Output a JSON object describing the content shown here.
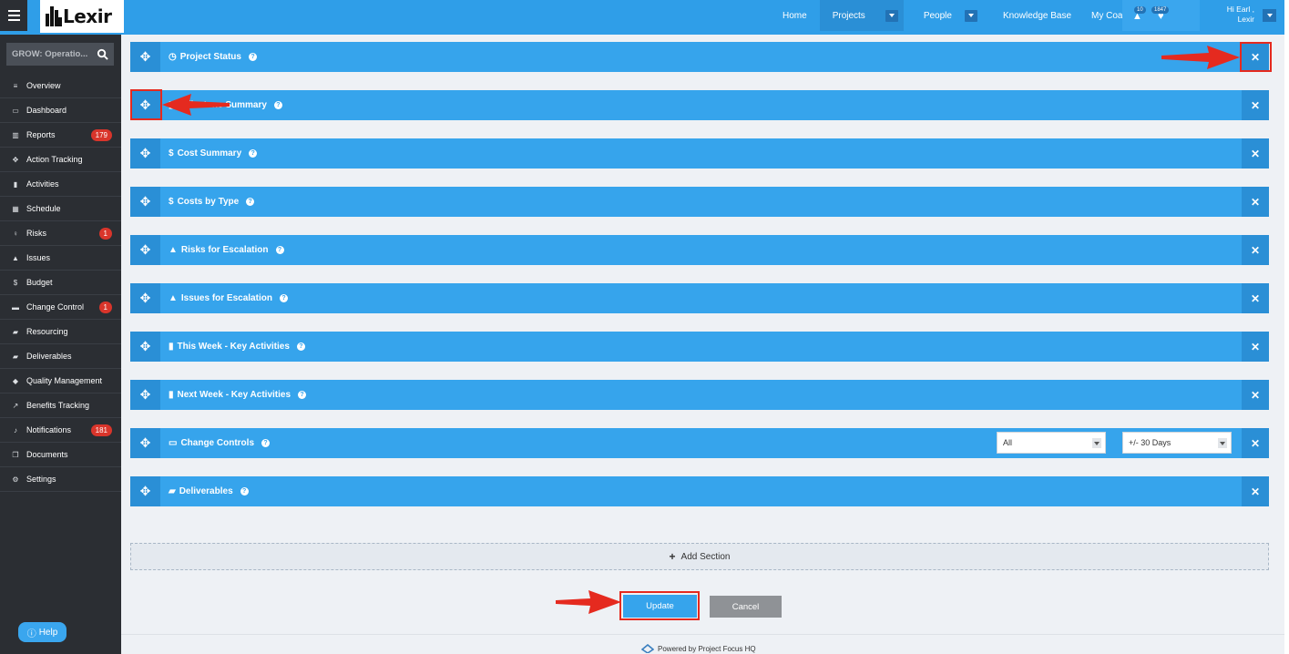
{
  "header": {
    "logo": "Lexir",
    "nav": [
      {
        "label": "Home",
        "active": false
      },
      {
        "label": "Projects",
        "active": true
      },
      {
        "label": "People",
        "active": false
      },
      {
        "label": "Knowledge Base",
        "active": false
      },
      {
        "label": "My Coaching",
        "active": false
      }
    ],
    "alert_count": "10",
    "notif_count": "1847",
    "greeting": "Hi Earl ,",
    "user_name": "Lexir"
  },
  "sidebar": {
    "search_value": "GROW: Operatio...",
    "items": [
      {
        "label": "Overview",
        "icon": "list-icon",
        "glyph": "≡"
      },
      {
        "label": "Dashboard",
        "icon": "dashboard-icon",
        "glyph": "▭"
      },
      {
        "label": "Reports",
        "icon": "bar-chart-icon",
        "glyph": "▥",
        "badge": "179"
      },
      {
        "label": "Action Tracking",
        "icon": "crosshair-icon",
        "glyph": "✥"
      },
      {
        "label": "Activities",
        "icon": "bookmark-icon",
        "glyph": "▮"
      },
      {
        "label": "Schedule",
        "icon": "calendar-icon",
        "glyph": "▦"
      },
      {
        "label": "Risks",
        "icon": "lightbulb-icon",
        "glyph": "♀",
        "badge": "1"
      },
      {
        "label": "Issues",
        "icon": "warning-icon",
        "glyph": "▲"
      },
      {
        "label": "Budget",
        "icon": "dollar-icon",
        "glyph": "$"
      },
      {
        "label": "Change Control",
        "icon": "card-icon",
        "glyph": "▬",
        "badge": "1"
      },
      {
        "label": "Resourcing",
        "icon": "folder-icon",
        "glyph": "▰"
      },
      {
        "label": "Deliverables",
        "icon": "truck-icon",
        "glyph": "▰"
      },
      {
        "label": "Quality Management",
        "icon": "tag-icon",
        "glyph": "◆"
      },
      {
        "label": "Benefits Tracking",
        "icon": "line-chart-icon",
        "glyph": "↗"
      },
      {
        "label": "Notifications",
        "icon": "bell-icon",
        "glyph": "♪",
        "badge": "181"
      },
      {
        "label": "Documents",
        "icon": "copy-icon",
        "glyph": "❐"
      },
      {
        "label": "Settings",
        "icon": "cogs-icon",
        "glyph": "⚙"
      }
    ],
    "help_label": "Help"
  },
  "sections": [
    {
      "title": "Project Status",
      "icon": "clock-icon",
      "glyph": "◷"
    },
    {
      "title": "Milestone Summary",
      "icon": "calendar-icon",
      "glyph": "▦"
    },
    {
      "title": "Cost Summary",
      "icon": "dollar-icon",
      "glyph": "$"
    },
    {
      "title": "Costs by Type",
      "icon": "dollar-icon",
      "glyph": "$"
    },
    {
      "title": "Risks for Escalation",
      "icon": "warning-icon",
      "glyph": "▲"
    },
    {
      "title": "Issues for Escalation",
      "icon": "warning-icon",
      "glyph": "▲"
    },
    {
      "title": "This Week - Key Activities",
      "icon": "bookmark-icon",
      "glyph": "▮"
    },
    {
      "title": "Next Week - Key Activities",
      "icon": "bookmark-icon",
      "glyph": "▮"
    },
    {
      "title": "Change Controls",
      "icon": "folder-icon",
      "glyph": "▭"
    },
    {
      "title": "Deliverables",
      "icon": "truck-icon",
      "glyph": "▰"
    }
  ],
  "change_controls_filters": {
    "status": "All",
    "range": "+/- 30 Days"
  },
  "add_section_label": "Add Section",
  "update_label": "Update",
  "cancel_label": "Cancel",
  "footer_text": "Powered by Project Focus HQ",
  "colors": {
    "primary": "#36a4ec",
    "dark": "#2b2e33",
    "badge": "#d9352b",
    "annotation": "#e52a1f"
  }
}
